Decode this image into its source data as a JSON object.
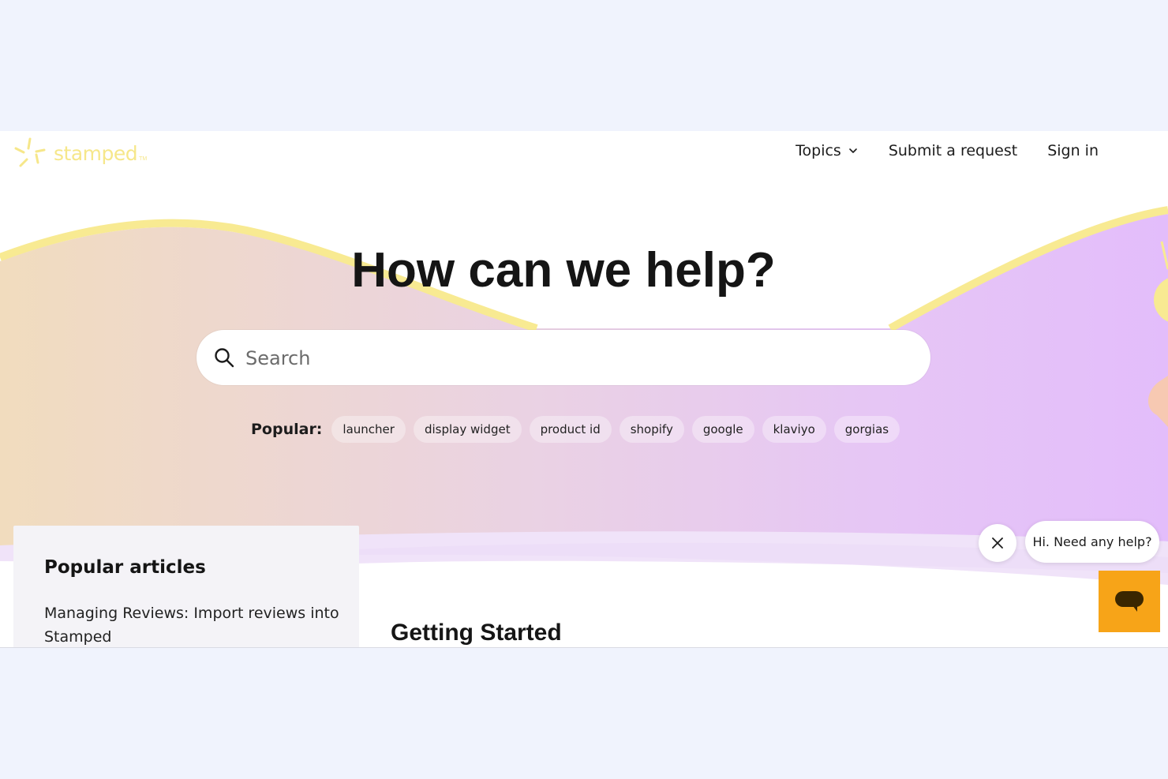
{
  "header": {
    "logo_text": "stamped",
    "logo_tm": "TM",
    "nav": {
      "topics_label": "Topics",
      "submit_label": "Submit a request",
      "signin_label": "Sign in"
    }
  },
  "hero": {
    "title": "How can we help?",
    "search": {
      "placeholder": "Search",
      "value": ""
    },
    "popular": {
      "label": "Popular:",
      "tags": [
        "launcher",
        "display widget",
        "product id",
        "shopify",
        "google",
        "klaviyo",
        "gorgias"
      ]
    }
  },
  "popular_articles": {
    "title": "Popular articles",
    "items": [
      "Managing Reviews: Import reviews into Stamped"
    ]
  },
  "main": {
    "section_title": "Getting Started"
  },
  "chat": {
    "greeting": "Hi. Need any help?"
  },
  "colors": {
    "brand_yellow": "#f6e78a",
    "launcher_orange": "#f7a418",
    "gradient_left": "#f1dcbe",
    "gradient_right": "#e3bdfb"
  }
}
